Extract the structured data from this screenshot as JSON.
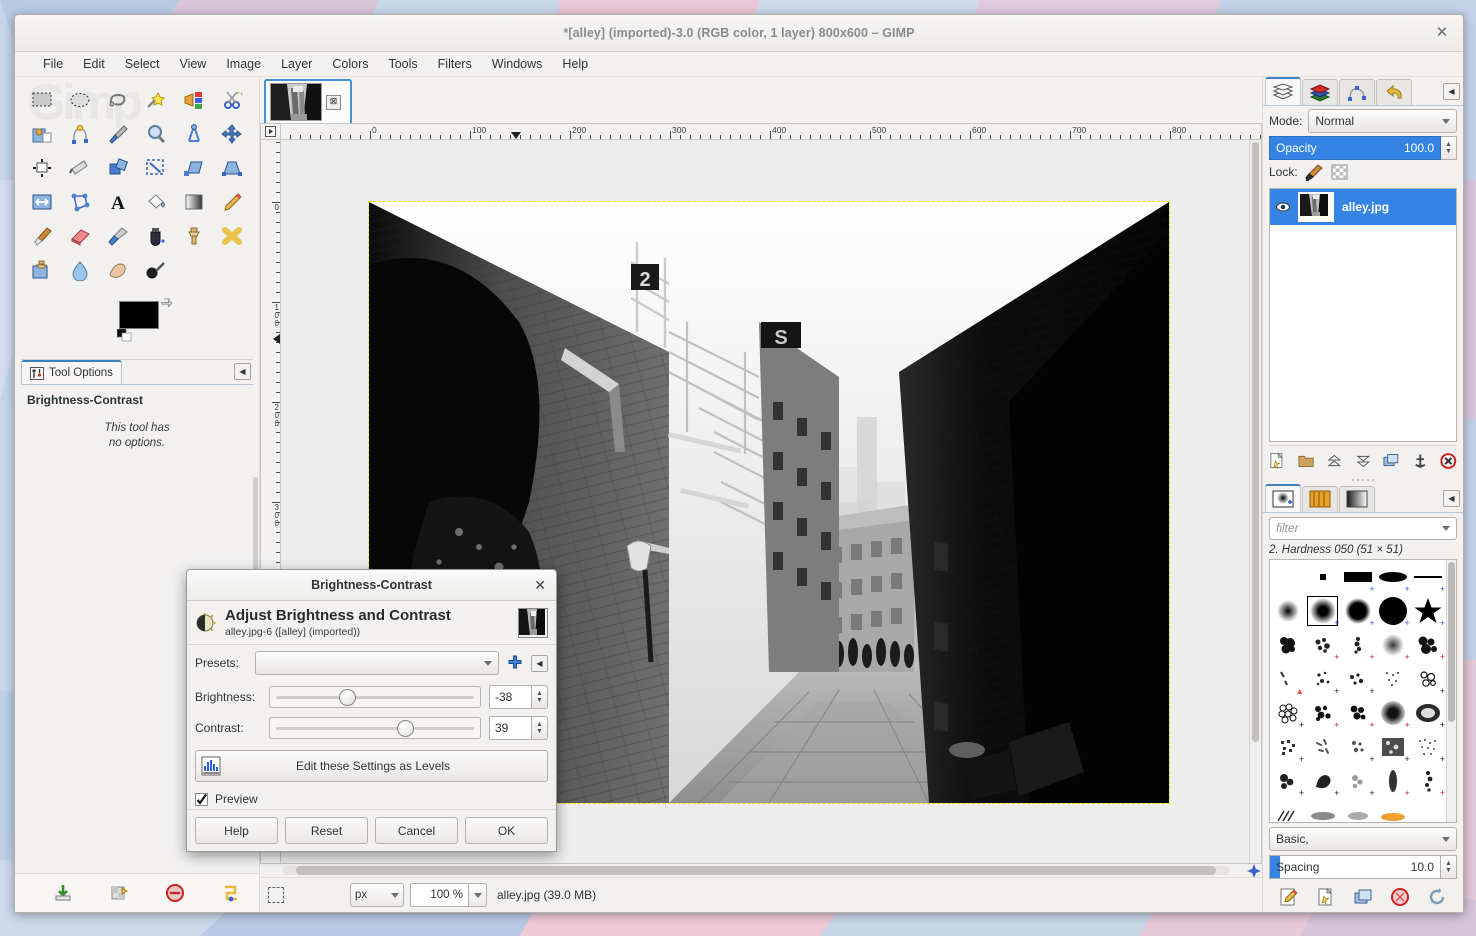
{
  "window": {
    "title": "*[alley] (imported)-3.0 (RGB color, 1 layer) 800x600 – GIMP",
    "close_label": "✕"
  },
  "menubar": {
    "items": [
      {
        "label": "File"
      },
      {
        "label": "Edit"
      },
      {
        "label": "Select"
      },
      {
        "label": "View"
      },
      {
        "label": "Image"
      },
      {
        "label": "Layer"
      },
      {
        "label": "Colors"
      },
      {
        "label": "Tools"
      },
      {
        "label": "Filters"
      },
      {
        "label": "Windows"
      },
      {
        "label": "Help"
      }
    ]
  },
  "toolbox": {
    "tools": [
      "rect-select-tool",
      "ellipse-select-tool",
      "free-select-tool",
      "fuzzy-select-tool",
      "select-by-color-tool",
      "scissors-select-tool",
      "foreground-select-tool",
      "paths-tool",
      "color-picker-tool",
      "zoom-tool",
      "measure-tool",
      "move-tool",
      "alignment-tool",
      "crop-tool",
      "rotate-tool",
      "scale-tool",
      "shear-tool",
      "perspective-tool",
      "flip-tool",
      "cage-transform-tool",
      "text-tool",
      "bucket-fill-tool",
      "gradient-tool",
      "pencil-tool",
      "paintbrush-tool",
      "eraser-tool",
      "airbrush-tool",
      "ink-tool",
      "clone-tool",
      "heal-tool",
      "perspective-clone-tool",
      "blur-sharpen-tool",
      "smudge-tool",
      "dodge-burn-tool"
    ],
    "foreground_color": "#000000",
    "background_color": "#ffffff"
  },
  "tool_options": {
    "tab_label": "Tool Options",
    "tool_name": "Brightness-Contrast",
    "note_line1": "This tool has",
    "note_line2": "no options."
  },
  "left_bottom_buttons": [
    "save-tool-preset-icon",
    "restore-tool-preset-icon",
    "delete-tool-preset-icon",
    "reset-tool-options-icon"
  ],
  "image_tab": {
    "name": "alley-image-tab",
    "close_label": "⊠"
  },
  "rulers": {
    "horizontal_ticks": [
      "0",
      "100",
      "200",
      "300",
      "400",
      "500",
      "600",
      "700",
      "800"
    ],
    "vertical_ticks": [
      "0",
      "100",
      "200",
      "300"
    ],
    "unit": "px"
  },
  "statusbar": {
    "unit": "px",
    "zoom": "100 %",
    "text": "alley.jpg (39.0 MB)"
  },
  "layers_dock": {
    "tabs": [
      "layers-tab",
      "channels-tab",
      "paths-tab",
      "undo-history-tab"
    ],
    "mode_label": "Mode:",
    "mode_value": "Normal",
    "opacity_label": "Opacity",
    "opacity_value": "100.0",
    "lock_label": "Lock:",
    "lock_buttons": [
      "lock-pixels-icon",
      "lock-alpha-icon"
    ],
    "layers": [
      {
        "name": "alley.jpg",
        "selected": true
      }
    ],
    "buttons": [
      "new-layer-icon",
      "new-layer-group-icon",
      "raise-layer-icon",
      "lower-layer-icon",
      "duplicate-layer-icon",
      "anchor-layer-icon",
      "delete-layer-icon"
    ]
  },
  "brushes_dock": {
    "tabs": [
      "brushes-tab",
      "patterns-tab",
      "gradients-tab"
    ],
    "filter_placeholder": "filter",
    "selected_brush": "2. Hardness 050 (51 × 51)",
    "preset_select": "Basic,",
    "spacing_label": "Spacing",
    "spacing_value": "10.0",
    "buttons": [
      "edit-brush-icon",
      "new-brush-icon",
      "duplicate-brush-icon",
      "delete-brush-icon",
      "refresh-brushes-icon"
    ]
  },
  "dialog": {
    "title": "Brightness-Contrast",
    "close_label": "✕",
    "heading": "Adjust Brightness and Contrast",
    "subheading": "alley.jpg-6 ([alley] (imported))",
    "presets_label": "Presets:",
    "presets_value": "",
    "add_preset_icon": "plus-icon",
    "preset_menu_icon": "preset-menu-icon",
    "sliders": [
      {
        "label": "Brightness:",
        "value": "-38",
        "min": -127,
        "max": 127,
        "numeric": -38
      },
      {
        "label": "Contrast:",
        "value": "39",
        "min": -127,
        "max": 127,
        "numeric": 39
      }
    ],
    "levels_button": "Edit these Settings as Levels",
    "preview_label": "Preview",
    "preview_checked": true,
    "buttons": [
      {
        "label": "Help",
        "name": "help-button"
      },
      {
        "label": "Reset",
        "name": "reset-button"
      },
      {
        "label": "Cancel",
        "name": "cancel-button"
      },
      {
        "label": "OK",
        "name": "ok-button"
      }
    ]
  },
  "colors": {
    "accent": "#3584e4",
    "selection_dash": "#e8e800",
    "tab_active_top": "#3c7fc0"
  }
}
